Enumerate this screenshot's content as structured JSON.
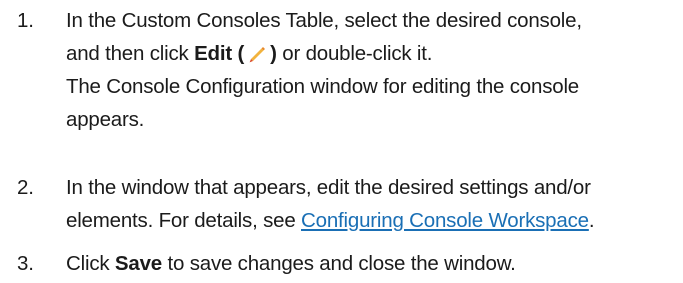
{
  "steps": [
    {
      "number": "1.",
      "line1": "In the Custom Consoles Table, select the desired console,",
      "line2_prefix": "and then click ",
      "edit_bold": "Edit (",
      "edit_close": ")",
      "line2_suffix": " or double-click it.",
      "line3": "The Console Configuration window for editing the console",
      "line4": "appears."
    },
    {
      "number": "2.",
      "line1": "In the window that appears, edit the desired settings and/or",
      "line2_prefix": "elements. For details, see ",
      "link_text": "Configuring Console Workspace",
      "line2_suffix": "."
    },
    {
      "number": "3.",
      "prefix": "Click ",
      "save_bold": "Save",
      "suffix": " to save changes and close the window."
    }
  ],
  "icons": {
    "edit": "pencil-icon"
  },
  "colors": {
    "text": "#1b1b1b",
    "link": "#1a6fb5",
    "pencil_body": "#f2b33d",
    "pencil_tip": "#d94a2b"
  }
}
